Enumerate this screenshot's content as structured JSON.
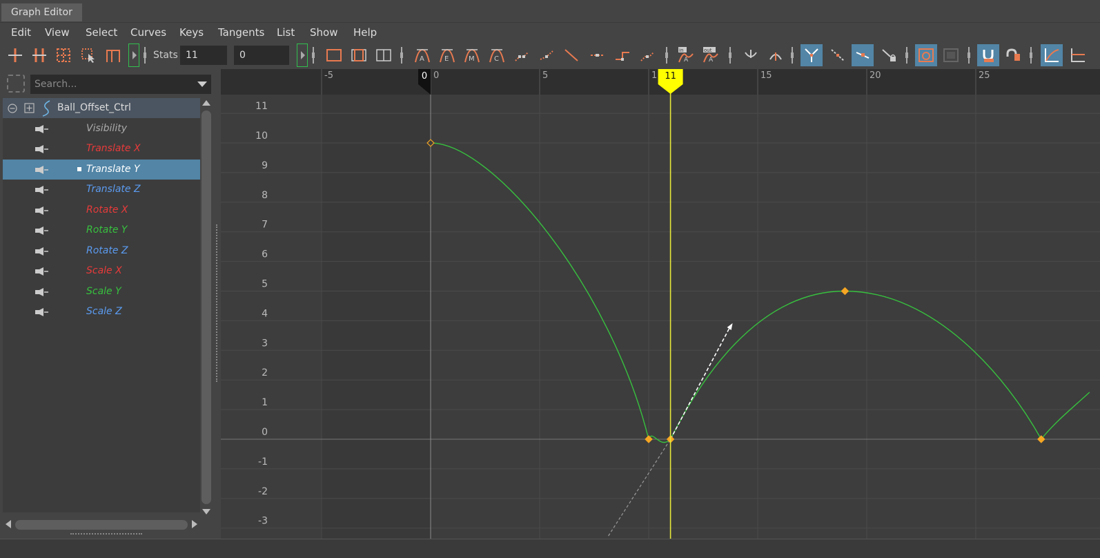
{
  "window": {
    "tab_title": "Graph Editor"
  },
  "menu": [
    "Edit",
    "View",
    "Select",
    "Curves",
    "Keys",
    "Tangents",
    "List",
    "Show",
    "Help"
  ],
  "toolbar": {
    "stats_label": "Stats",
    "stats_frame": "11",
    "stats_value": "0",
    "icons_left": [
      "move-key-icon",
      "insert-key-icon",
      "lattice-deform-icon",
      "region-select-icon",
      "buffer-curve-icon"
    ],
    "icons_frame": [
      "frame-all-icon",
      "frame-selection-icon",
      "frame-playback-range-icon"
    ],
    "icons_tangents": [
      "auto-tangent-icon",
      "spline-tangent-icon",
      "clamped-tangent-icon",
      "linear-tangent-icon",
      "flat-tangent-icon",
      "step-tangent-icon",
      "plateau-tangent-icon"
    ],
    "icons_infinity": [
      "pre-infinity-icon",
      "post-infinity-icon"
    ],
    "icons_misc": [
      "break-tangents-icon",
      "unify-tangents-icon",
      "normalize-icon",
      "isolate-curve-icon",
      "lock-tangent-weight-icon",
      "show-results-icon",
      "time-snap-icon",
      "value-snap-icon",
      "curve-display-icon",
      "stacked-view-icon"
    ]
  },
  "search": {
    "placeholder": "Search..."
  },
  "outliner": {
    "root": {
      "label": "Ball_Offset_Ctrl"
    },
    "attributes": [
      {
        "label": "Visibility",
        "color": "#aaaaaa",
        "selected": false
      },
      {
        "label": "Translate X",
        "color": "#e83a3a",
        "selected": false
      },
      {
        "label": "Translate Y",
        "color": "#ffffff",
        "selected": true
      },
      {
        "label": "Translate Z",
        "color": "#5b9bf0",
        "selected": false
      },
      {
        "label": "Rotate X",
        "color": "#e83a3a",
        "selected": false
      },
      {
        "label": "Rotate Y",
        "color": "#37c13e",
        "selected": false
      },
      {
        "label": "Rotate Z",
        "color": "#5b9bf0",
        "selected": false
      },
      {
        "label": "Scale X",
        "color": "#e83a3a",
        "selected": false
      },
      {
        "label": "Scale Y",
        "color": "#37c13e",
        "selected": false
      },
      {
        "label": "Scale Z",
        "color": "#5b9bf0",
        "selected": false
      }
    ]
  },
  "graph": {
    "time_labels": [
      "-5",
      "0",
      "5",
      "1",
      "15",
      "20",
      "25"
    ],
    "time_ticks": [
      -5,
      0,
      5,
      10,
      15,
      20,
      25
    ],
    "value_labels": [
      "11",
      "10",
      "9",
      "8",
      "7",
      "6",
      "5",
      "4",
      "3",
      "2",
      "1",
      "0",
      "-1",
      "-2",
      "-3"
    ],
    "value_ticks": [
      11,
      10,
      9,
      8,
      7,
      6,
      5,
      4,
      3,
      2,
      1,
      0,
      -1,
      -2,
      -3
    ],
    "current_time_label": "11",
    "current_time": 11,
    "start_marker_label": "0",
    "start_marker_time": 0,
    "curve_color": "#37c13e",
    "key_color": "#f5a623",
    "timeline_color": "#e8e83a",
    "keys": [
      {
        "time": 0,
        "value": 10
      },
      {
        "time": 10,
        "value": 0
      },
      {
        "time": 11,
        "value": 0
      },
      {
        "time": 19,
        "value": 5
      },
      {
        "time": 28,
        "value": 0
      }
    ]
  }
}
